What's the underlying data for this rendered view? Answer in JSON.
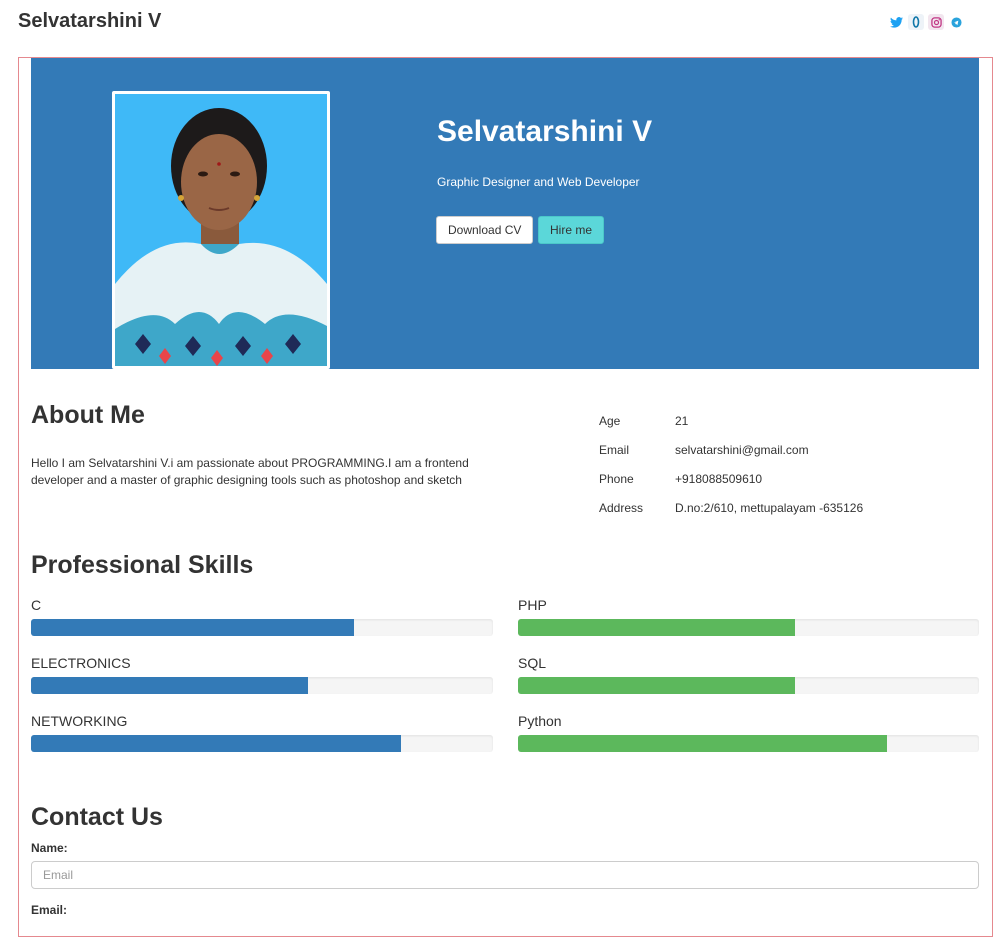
{
  "header": {
    "brand": "Selvatarshini V",
    "social_icons": [
      "twitter-icon",
      "linkedin-icon",
      "instagram-icon",
      "telegram-icon"
    ]
  },
  "hero": {
    "name": "Selvatarshini V",
    "tagline": "Graphic Designer and Web Developer",
    "download_cv_label": "Download CV",
    "hire_me_label": "Hire me",
    "background_color": "#337ab7"
  },
  "about": {
    "heading": "About Me",
    "text": "Hello I am Selvatarshini V.i am passionate about PROGRAMMING.I am a frontend developer and a master of graphic designing tools such as photoshop and sketch",
    "info": [
      {
        "key": "Age",
        "value": "21"
      },
      {
        "key": "Email",
        "value": "selvatarshini@gmail.com"
      },
      {
        "key": "Phone",
        "value": "+918088509610"
      },
      {
        "key": "Address",
        "value": "D.no:2/610, mettupalayam -635126"
      }
    ]
  },
  "skills": {
    "heading": "Professional Skills",
    "left": [
      {
        "name": "C",
        "percent": 70,
        "color": "#337ab7"
      },
      {
        "name": "ELECTRONICS",
        "percent": 60,
        "color": "#337ab7"
      },
      {
        "name": "NETWORKING",
        "percent": 80,
        "color": "#337ab7"
      }
    ],
    "right": [
      {
        "name": "PHP",
        "percent": 60,
        "color": "#5cb85c"
      },
      {
        "name": "SQL",
        "percent": 60,
        "color": "#5cb85c"
      },
      {
        "name": "Python",
        "percent": 80,
        "color": "#5cb85c"
      }
    ]
  },
  "contact": {
    "heading": "Contact Us",
    "name_label": "Name:",
    "name_placeholder": "Email",
    "email_label": "Email:"
  }
}
